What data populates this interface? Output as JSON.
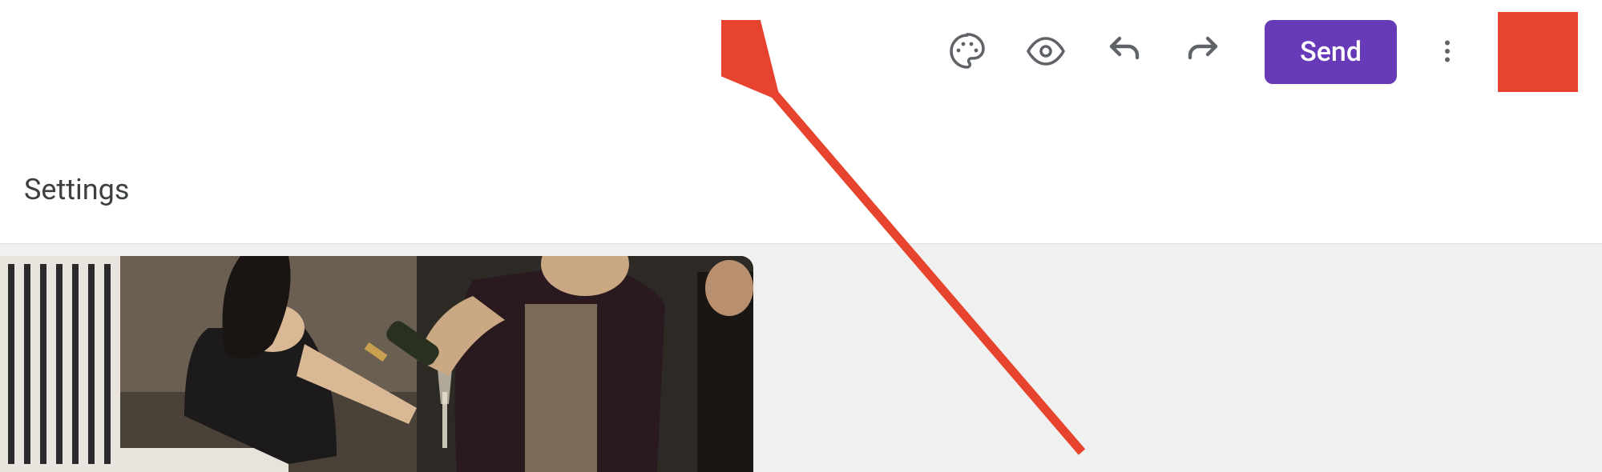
{
  "toolbar": {
    "theme_icon": "palette-icon",
    "preview_icon": "eye-icon",
    "undo_icon": "undo-icon",
    "redo_icon": "redo-icon",
    "send_label": "Send",
    "more_icon": "more-vert-icon"
  },
  "tabs": {
    "settings_label": "Settings"
  },
  "colors": {
    "primary": "#673ab7",
    "accent": "#e8432e",
    "icon": "#5f6368"
  },
  "annotation": {
    "target": "palette-icon",
    "arrow_color": "#e8432e"
  }
}
